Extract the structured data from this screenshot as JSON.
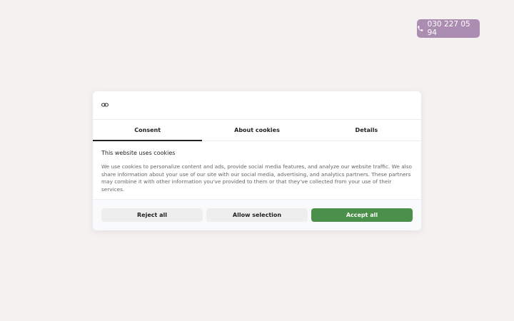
{
  "phone": {
    "icon": "phone-icon",
    "number": "030 227 05 94",
    "color": "#ab8db2"
  },
  "dialog": {
    "logo_icon": "cookie-link-icon",
    "tabs": [
      {
        "label": "Consent",
        "active": true
      },
      {
        "label": "About cookies",
        "active": false
      },
      {
        "label": "Details",
        "active": false
      }
    ],
    "title": "This website uses cookies",
    "text": "We use cookies to personalize content and ads, provide social media features, and analyze our website traffic. We also share information about your use of our site with our social media, advertising, and analytics partners. These partners may combine it with other information you've provided to them or that they've collected from your use of their services.",
    "buttons": {
      "reject": "Reject all",
      "allow_selection": "Allow selection",
      "accept": "Accept all"
    },
    "accept_color": "#4a8f4a"
  }
}
